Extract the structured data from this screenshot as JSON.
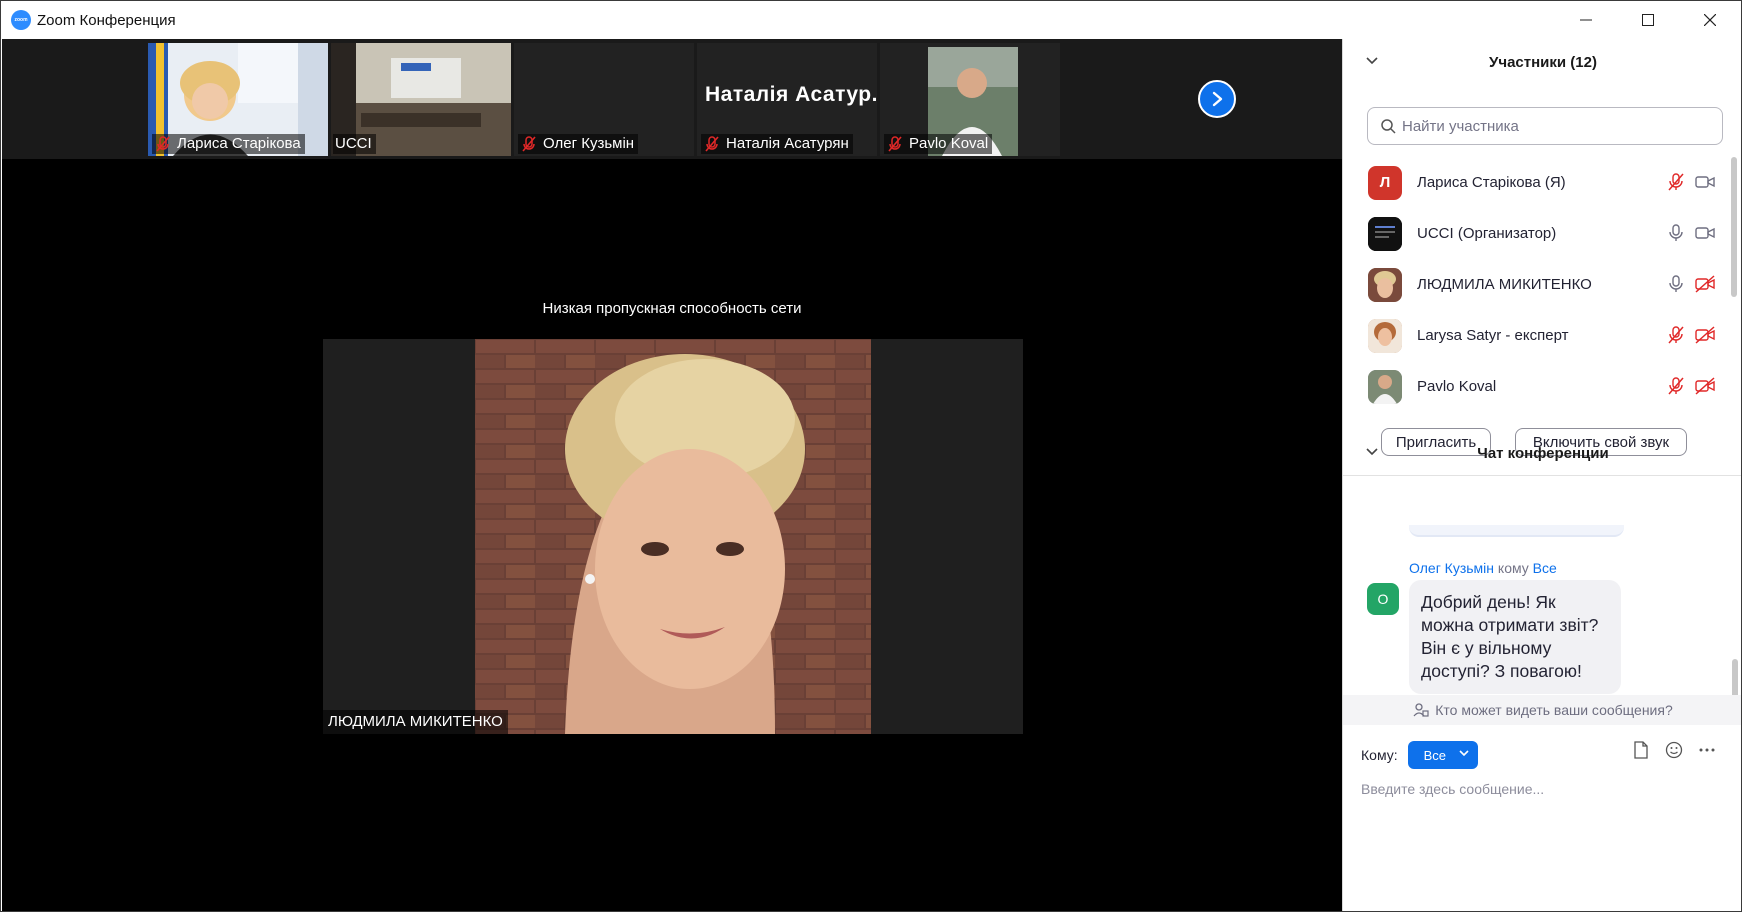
{
  "window": {
    "title": "Zoom Конференция",
    "logo_text": "zoom"
  },
  "thumbnails": [
    {
      "name": "Лариса Старікова",
      "muted": true
    },
    {
      "name": "UCCI",
      "muted": false
    },
    {
      "name": "Олег Кузьмін",
      "muted": true
    },
    {
      "name": "Наталія Асатурян",
      "muted": true,
      "big_name": "Наталія Асатур..."
    },
    {
      "name": "Pavlo Koval",
      "muted": true
    }
  ],
  "main_video": {
    "notice": "Низкая пропускная способность сети",
    "speaker": "ЛЮДМИЛА МИКИТЕНКО"
  },
  "participants_panel": {
    "title": "Участники (12)",
    "search_placeholder": "Найти участника",
    "items": [
      {
        "name": "Лариса Старікова (Я)",
        "avatar_letter": "Л",
        "avatar_color": "#d0352b",
        "mic": "muted",
        "video": "on"
      },
      {
        "name": "UCCI (Организатор)",
        "avatar_letter": "",
        "avatar_color": "#151515",
        "mic": "on",
        "video": "on"
      },
      {
        "name": "ЛЮДМИЛА МИКИТЕНКО",
        "avatar_letter": "",
        "avatar_color": "#b88a6a",
        "mic": "on",
        "video": "off"
      },
      {
        "name": "Larysa Satyr - експерт",
        "avatar_letter": "",
        "avatar_color": "#c28d63",
        "mic": "muted",
        "video": "off"
      },
      {
        "name": "Pavlo Koval",
        "avatar_letter": "",
        "avatar_color": "#8a8f95",
        "mic": "muted",
        "video": "off"
      }
    ],
    "invite_label": "Пригласить",
    "unmute_label": "Включить свой звук"
  },
  "chat_panel": {
    "title": "Чат конференции",
    "messages": [
      {
        "sender": "Олег Кузьмін",
        "to_word": "кому",
        "to": "Все",
        "avatar_letter": "О",
        "text": "Добрий день! Як можна отримати звіт? Він є у вільному доступі? З повагою!"
      }
    ],
    "who_can_see": "Кто может видеть ваши сообщения?",
    "to_label": "Кому:",
    "to_value": "Все",
    "input_placeholder": "Введите здесь сообщение..."
  },
  "colors": {
    "accent": "#0e71eb",
    "mute_red": "#e02828",
    "dark_bg": "#000000"
  }
}
